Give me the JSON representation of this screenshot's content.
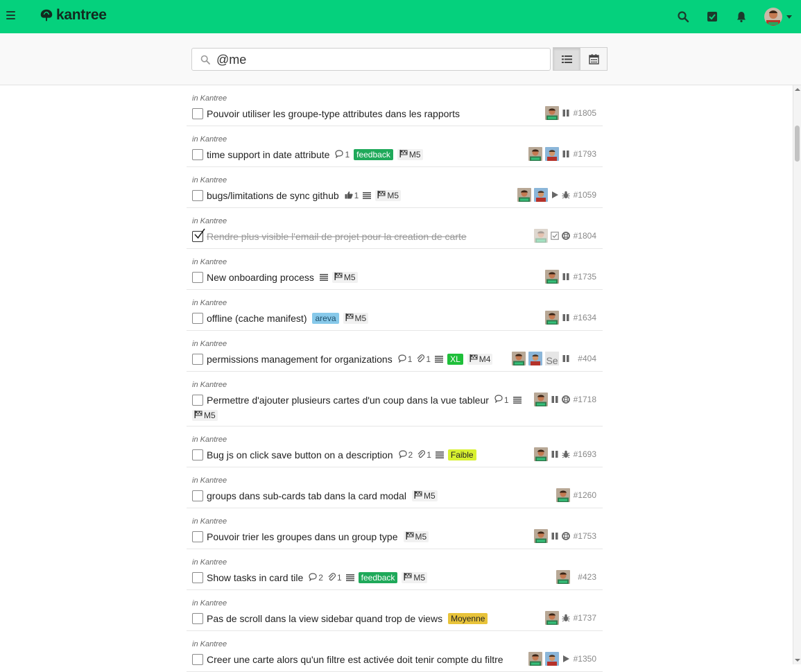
{
  "app": {
    "name": "kantree",
    "brand_color": "#05d17d"
  },
  "header": {
    "icons": [
      "menu-icon",
      "search-icon",
      "tasks-icon",
      "bell-icon",
      "user-avatar"
    ],
    "search_value": "@me"
  },
  "colors": {
    "feedback": "#1fa95a",
    "areva": "#87c9ea",
    "xl": "#1fbf3a",
    "faible": "#d8f130",
    "moyenne": "#e8c33a"
  },
  "cards": [
    {
      "project": "in Kantree",
      "title": "Pouvoir utiliser les groupe-type attributes dans les rapports",
      "done": false,
      "comments": "",
      "attachments": "",
      "desc": false,
      "tags": [],
      "milestone": "",
      "assignees": 1,
      "icons": [
        "pause-icon"
      ],
      "number": "#1805"
    },
    {
      "project": "in Kantree",
      "title": "time support in date attribute",
      "done": false,
      "comments": "1",
      "attachments": "",
      "desc": false,
      "tags": [
        {
          "text": "feedback",
          "key": "feedback"
        }
      ],
      "milestone": "M5",
      "assignees": 2,
      "icons": [
        "pause-icon"
      ],
      "number": "#1793"
    },
    {
      "project": "in Kantree",
      "title": "bugs/limitations de sync github",
      "done": false,
      "comments": "",
      "likes": "1",
      "attachments": "",
      "desc": true,
      "tags": [],
      "milestone": "M5",
      "assignees": 2,
      "icons": [
        "play-icon",
        "bug-icon"
      ],
      "number": "#1059"
    },
    {
      "project": "in Kantree",
      "title": "Rendre plus visible l'email de projet pour la creation de carte",
      "done": true,
      "comments": "",
      "attachments": "",
      "desc": false,
      "tags": [],
      "milestone": "",
      "assignees": 1,
      "icons": [
        "checked-box-icon",
        "support-icon"
      ],
      "number": "#1804"
    },
    {
      "project": "in Kantree",
      "title": "New onboarding process",
      "done": false,
      "comments": "",
      "attachments": "",
      "desc": true,
      "tags": [],
      "milestone": "M5",
      "assignees": 1,
      "icons": [
        "pause-icon"
      ],
      "number": "#1735"
    },
    {
      "project": "in Kantree",
      "title": "offline (cache manifest)",
      "done": false,
      "comments": "",
      "attachments": "",
      "desc": false,
      "tags": [
        {
          "text": "areva",
          "key": "areva"
        }
      ],
      "milestone": "M5",
      "assignees": 1,
      "icons": [
        "pause-icon"
      ],
      "number": "#1634"
    },
    {
      "project": "in Kantree",
      "title": "permissions management for organizations",
      "done": false,
      "comments": "1",
      "attachments": "1",
      "desc": true,
      "tags": [
        {
          "text": "XL",
          "key": "xl"
        }
      ],
      "milestone": "M4",
      "assignees": 2,
      "extra_avatar": "Se",
      "icons": [
        "pause-icon"
      ],
      "number": "#404"
    },
    {
      "project": "in Kantree",
      "title": "Permettre d'ajouter plusieurs cartes d'un coup dans la vue tableur",
      "done": false,
      "comments": "1",
      "attachments": "",
      "desc": true,
      "tags": [],
      "milestone": "M5",
      "milestone_wrap": true,
      "assignees": 1,
      "icons": [
        "pause-icon",
        "support-icon"
      ],
      "number": "#1718"
    },
    {
      "project": "in Kantree",
      "title": "Bug js on click save button on a description",
      "done": false,
      "comments": "2",
      "attachments": "1",
      "desc": true,
      "tags": [
        {
          "text": "Faible",
          "key": "faible"
        }
      ],
      "milestone": "",
      "assignees": 1,
      "icons": [
        "pause-icon",
        "bug-icon"
      ],
      "number": "#1693"
    },
    {
      "project": "in Kantree",
      "title": "groups dans sub-cards tab dans la card modal",
      "done": false,
      "comments": "",
      "attachments": "",
      "desc": false,
      "tags": [],
      "milestone": "M5",
      "assignees": 1,
      "icons": [],
      "number": "#1260"
    },
    {
      "project": "in Kantree",
      "title": "Pouvoir trier les groupes dans un group type",
      "done": false,
      "comments": "",
      "attachments": "",
      "desc": false,
      "tags": [],
      "milestone": "M5",
      "assignees": 1,
      "icons": [
        "pause-icon",
        "support-icon"
      ],
      "number": "#1753"
    },
    {
      "project": "in Kantree",
      "title": "Show tasks in card tile",
      "done": false,
      "comments": "2",
      "attachments": "1",
      "desc": true,
      "tags": [
        {
          "text": "feedback",
          "key": "feedback"
        }
      ],
      "milestone": "M5",
      "assignees": 1,
      "icons": [],
      "number": "#423"
    },
    {
      "project": "in Kantree",
      "title": "Pas de scroll dans la view sidebar quand trop de views",
      "done": false,
      "comments": "",
      "attachments": "",
      "desc": false,
      "tags": [
        {
          "text": "Moyenne",
          "key": "moyenne"
        }
      ],
      "milestone": "",
      "assignees": 1,
      "icons": [
        "bug-icon"
      ],
      "number": "#1737"
    },
    {
      "project": "in Kantree",
      "title": "Creer une carte alors qu'un filtre est activée doit tenir compte du filtre",
      "done": false,
      "comments": "",
      "attachments": "",
      "desc": false,
      "tags": [],
      "milestone": "",
      "assignees": 2,
      "icons": [
        "play-icon"
      ],
      "number": "#1350"
    }
  ]
}
